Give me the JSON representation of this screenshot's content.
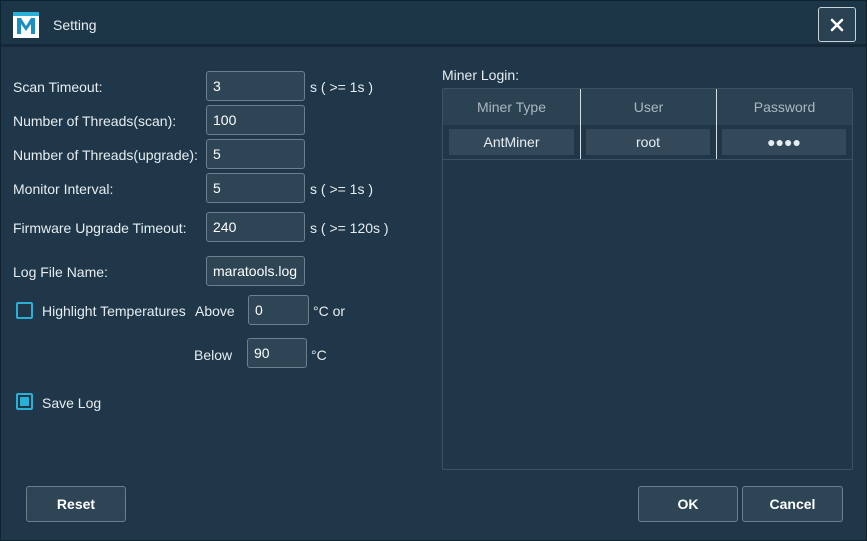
{
  "window": {
    "title": "Setting",
    "close_symbol": "✕"
  },
  "left": {
    "scan_timeout": {
      "label": "Scan Timeout:",
      "value": "3",
      "hint": "s ( >= 1s )"
    },
    "threads_scan": {
      "label": "Number of Threads(scan):",
      "value": "100"
    },
    "threads_upgrade": {
      "label": "Number of Threads(upgrade):",
      "value": "5"
    },
    "monitor_interval": {
      "label": "Monitor Interval:",
      "value": "5",
      "hint": "s ( >= 1s )"
    },
    "firmware_timeout": {
      "label": "Firmware Upgrade Timeout:",
      "value": "240",
      "hint": "s ( >= 120s )"
    },
    "log_file": {
      "label": "Log File Name:",
      "value": "maratools.log"
    },
    "highlight": {
      "label": "Highlight Temperatures",
      "checked": false,
      "above_label": "Above",
      "above_value": "0",
      "above_unit": "°C or",
      "below_label": "Below",
      "below_value": "90",
      "below_unit": "°C"
    },
    "save_log": {
      "label": "Save Log",
      "checked": true
    }
  },
  "miner_login": {
    "label": "Miner Login:",
    "columns": [
      "Miner Type",
      "User",
      "Password"
    ],
    "rows": [
      {
        "type": "AntMiner",
        "user": "root",
        "password": "●●●●"
      }
    ]
  },
  "buttons": {
    "reset": "Reset",
    "ok": "OK",
    "cancel": "Cancel"
  },
  "colors": {
    "background": "#1f3748",
    "accent": "#2ab0d6"
  }
}
